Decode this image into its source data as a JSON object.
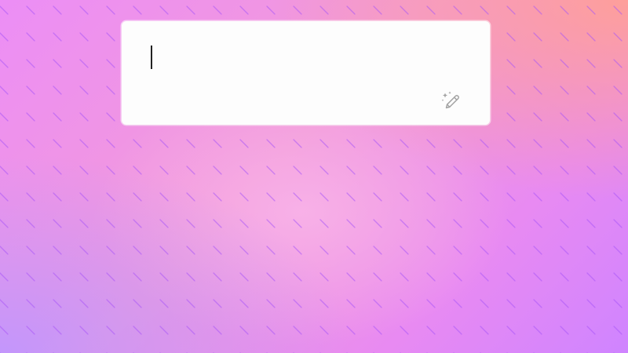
{
  "prompt": {
    "value": "",
    "placeholder": ""
  },
  "icons": {
    "magic_button": "magic-pencil-icon"
  },
  "colors": {
    "gradient_pink": "#f29ad8",
    "gradient_violet": "#cf84ff",
    "gradient_coral": "#ffa096",
    "pattern_stroke": "#a855f7",
    "card_background": "#fdfdfd",
    "icon_gray": "#a3a3a3"
  }
}
